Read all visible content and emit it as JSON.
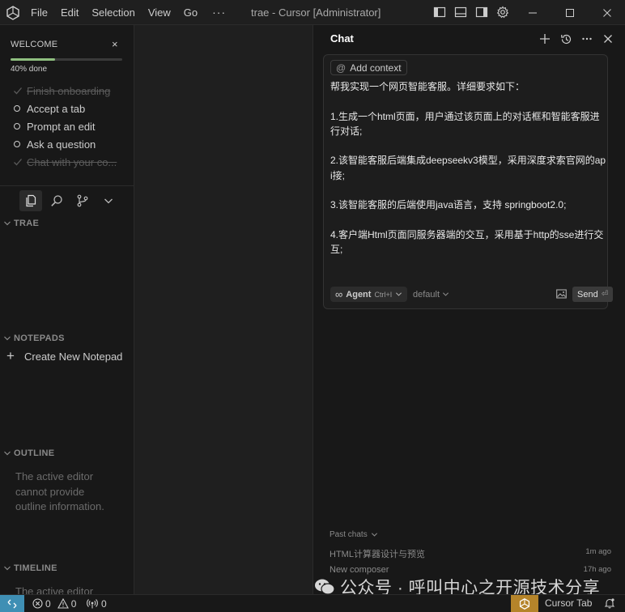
{
  "titlebar": {
    "menus": [
      "File",
      "Edit",
      "Selection",
      "View",
      "Go"
    ],
    "more": "···",
    "window_title": "trae - Cursor [Administrator]",
    "icons": [
      "cursor-logo-icon",
      "toggle-primary-sidebar-icon",
      "toggle-panel-icon",
      "toggle-secondary-sidebar-icon",
      "settings-gear-icon",
      "minimize-icon",
      "maximize-icon",
      "close-icon"
    ]
  },
  "welcome": {
    "header": "WELCOME",
    "close": "×",
    "progress_percent": 40,
    "progress_label": "40% done",
    "items": [
      {
        "label": "Finish onboarding",
        "done": true
      },
      {
        "label": "Accept a tab",
        "done": false
      },
      {
        "label": "Prompt an edit",
        "done": false
      },
      {
        "label": "Ask a question",
        "done": false
      },
      {
        "label": "Chat with your co...",
        "done": true
      }
    ]
  },
  "activity": {
    "icons": [
      "explorer-icon",
      "search-icon",
      "source-control-icon",
      "chevron-down-icon"
    ]
  },
  "sections": {
    "trae": "TRAE",
    "notepads": "NOTEPADS",
    "new_notepad": "Create New Notepad",
    "outline": "OUTLINE",
    "outline_message": "The active editor cannot provide outline information.",
    "timeline": "TIMELINE",
    "timeline_message": "The active editor"
  },
  "chat": {
    "tab": "Chat",
    "add_context": "Add context",
    "prompt": "帮我实现一个网页智能客服。详细要求如下：\n\n1.生成一个html页面，用户通过该页面上的对话框和智能客服进行对话;\n\n2.该智能客服后端集成deepseekv3模型，采用深度求索官网的api接;\n\n3.该智能客服的后端使用java语言，支持 springboot2.0;\n\n4.客户端Html页面同服务器端的交互，采用基于http的sse进行交互;",
    "mode": "Agent",
    "mode_shortcut": "Ctrl+I",
    "model": "default",
    "send": "Send",
    "send_shortcut": "⏎",
    "past_chats": "Past chats",
    "history": [
      {
        "title": "HTML计算器设计与预览",
        "time": "1m ago"
      },
      {
        "title": "New composer",
        "time": "17h ago"
      }
    ]
  },
  "watermark": "公众号 · 呼叫中心之开源技术分享",
  "statusbar": {
    "errors": "0",
    "warnings": "0",
    "ports": "0",
    "cursor_tab": "Cursor Tab"
  },
  "colors": {
    "progress": "#8fbf7f",
    "remote_badge": "#3f8fb4",
    "cursor_tab_badge": "#b5842a"
  }
}
